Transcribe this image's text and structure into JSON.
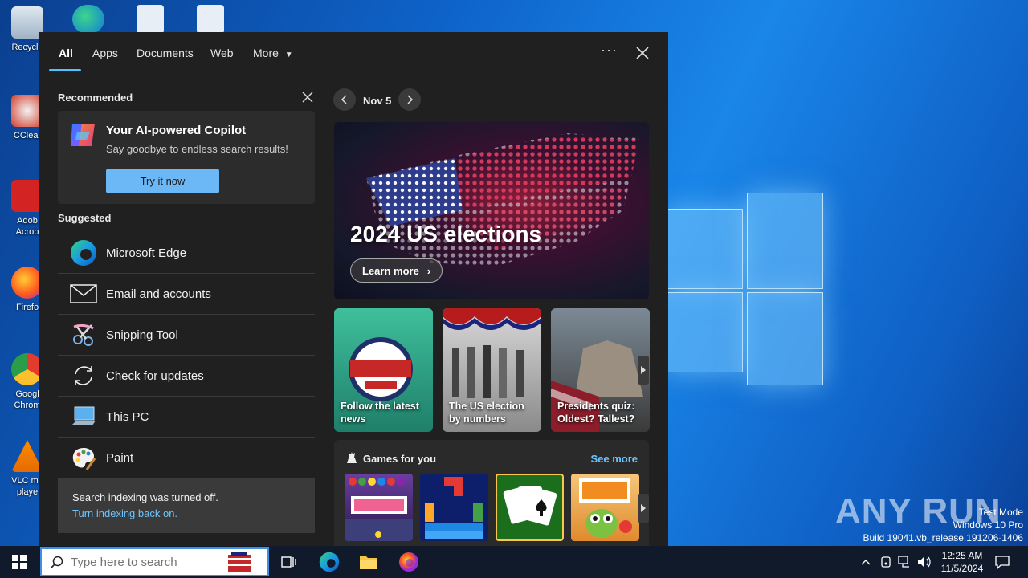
{
  "desktop": {
    "icons": [
      {
        "label": "Recycle"
      },
      {
        "label": "CClear"
      },
      {
        "label": "Adob Acrob"
      },
      {
        "label": "Firefo"
      },
      {
        "label": "Googl Chrom"
      },
      {
        "label": "VLC me playe"
      }
    ],
    "watermark": "ANY RUN",
    "system_text": {
      "line1": "Test Mode",
      "line2": "Windows 10 Pro",
      "line3": "Build 19041.vb_release.191206-1406"
    }
  },
  "panel": {
    "tabs": [
      "All",
      "Apps",
      "Documents",
      "Web",
      "More"
    ],
    "recommended": {
      "heading": "Recommended",
      "card_title": "Your AI-powered Copilot",
      "card_sub": "Say goodbye to endless search results!",
      "button": "Try it now"
    },
    "suggested": {
      "heading": "Suggested",
      "items": [
        {
          "label": "Microsoft Edge",
          "icon": "edge-icon"
        },
        {
          "label": "Email and accounts",
          "icon": "mail-icon"
        },
        {
          "label": "Snipping Tool",
          "icon": "scissors-icon"
        },
        {
          "label": "Check for updates",
          "icon": "refresh-icon"
        },
        {
          "label": "This PC",
          "icon": "computer-icon"
        },
        {
          "label": "Paint",
          "icon": "palette-icon"
        }
      ]
    },
    "indexing": {
      "text": "Search indexing was turned off.",
      "link": "Turn indexing back on."
    },
    "date": "Nov 5",
    "hero": {
      "title": "2024 US elections",
      "button": "Learn more"
    },
    "tiles": [
      {
        "label": "Follow the latest news"
      },
      {
        "label": "The US election by numbers"
      },
      {
        "label": "Presidents quiz: Oldest? Tallest?"
      }
    ],
    "games": {
      "heading": "Games for you",
      "see_more": "See more"
    }
  },
  "taskbar": {
    "search_placeholder": "Type here to search",
    "time": "12:25 AM",
    "date": "11/5/2024"
  },
  "colors": {
    "accent": "#4cc2ff",
    "panel_bg": "#202020",
    "button": "#6cb8f6"
  }
}
